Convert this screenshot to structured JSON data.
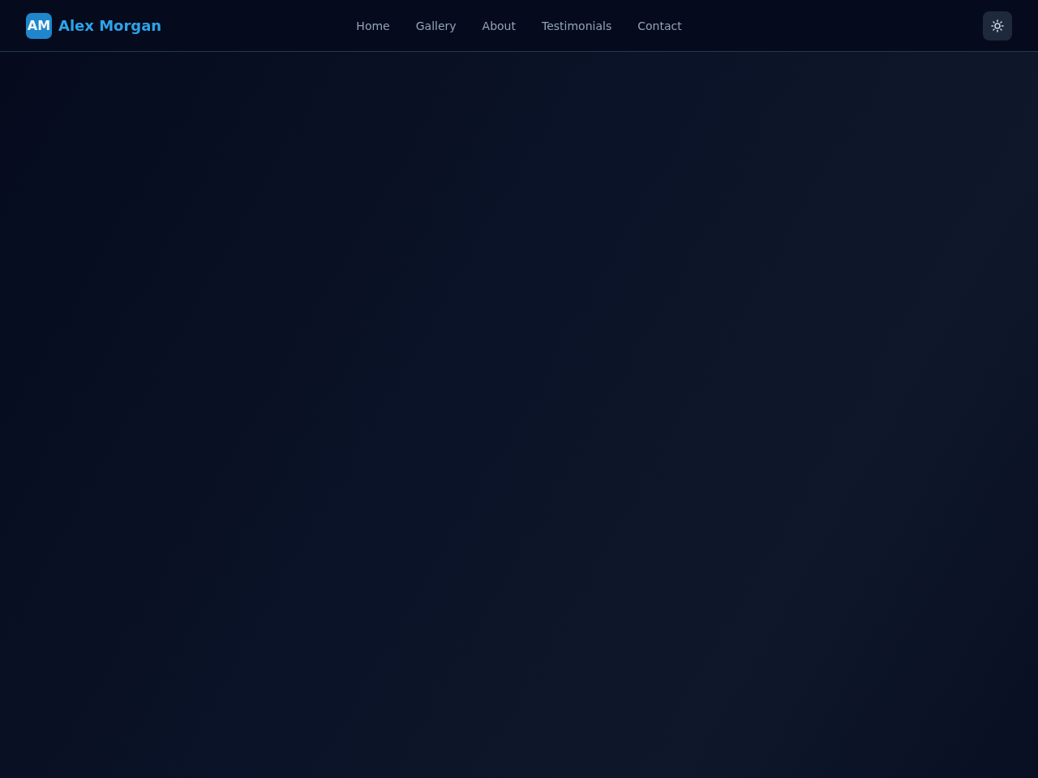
{
  "brand": {
    "initials": "AM",
    "name": "Alex Morgan"
  },
  "nav": [
    {
      "label": "Home"
    },
    {
      "label": "Gallery"
    },
    {
      "label": "About"
    },
    {
      "label": "Testimonials"
    },
    {
      "label": "Contact"
    }
  ]
}
